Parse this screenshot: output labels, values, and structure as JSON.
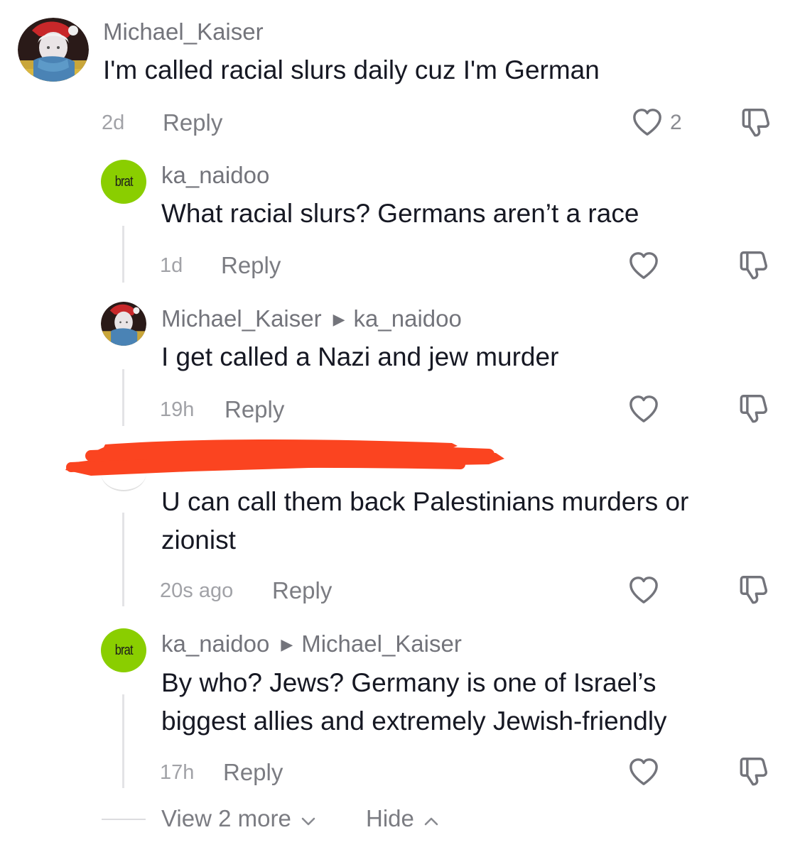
{
  "comments": [
    {
      "username": "Michael_Kaiser",
      "text": "I'm called racial slurs daily cuz I'm German",
      "time": "2d",
      "reply_label": "Reply",
      "like_count": "2"
    },
    {
      "username": "ka_naidoo",
      "avatar_text": "brat",
      "text": "What racial slurs? Germans aren’t a race",
      "time": "1d",
      "reply_label": "Reply"
    },
    {
      "username": "Michael_Kaiser",
      "reply_to": "ka_naidoo",
      "text": "I get called a Nazi and jew murder",
      "time": "19h",
      "reply_label": "Reply"
    },
    {
      "text_line1": "U can call them back Palestinians murders or",
      "text_line2": "zionist",
      "time": "20s ago",
      "reply_label": "Reply"
    },
    {
      "username": "ka_naidoo",
      "reply_to": "Michael_Kaiser",
      "avatar_text": "brat",
      "text_line1": "By who? Jews? Germany is one of Israel’s",
      "text_line2": "biggest allies and extremely Jewish-friendly",
      "time": "17h",
      "reply_label": "Reply"
    }
  ],
  "footer": {
    "view_more_label": "View 2 more",
    "hide_label": "Hide"
  },
  "colors": {
    "brat_green": "#8ace00",
    "redaction": "#fb4420",
    "meta_gray": "#a1a2a7"
  },
  "icons": [
    "heart-outline-icon",
    "thumbs-down-icon",
    "chevron-down-icon",
    "chevron-up-icon",
    "caret-right-icon"
  ]
}
